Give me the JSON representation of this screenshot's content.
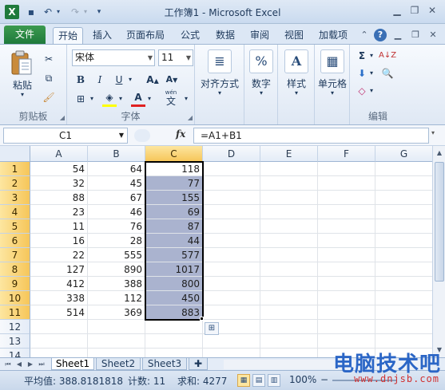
{
  "window": {
    "title": "工作簿1 - Microsoft Excel",
    "logo": "X",
    "qat": [
      "save-icon",
      "undo-icon",
      "redo-icon",
      "customize-icon"
    ]
  },
  "tabs": {
    "file": "文件",
    "items": [
      "开始",
      "插入",
      "页面布局",
      "公式",
      "数据",
      "审阅",
      "视图",
      "加载项"
    ],
    "active": "开始"
  },
  "ribbon": {
    "clipboard": {
      "label": "剪贴板",
      "paste": "粘贴"
    },
    "font": {
      "label": "字体",
      "name": "宋体",
      "size": "11",
      "wen": "wén",
      "wen_char": "文"
    },
    "alignment": {
      "label": "对齐方式"
    },
    "number": {
      "label": "数字"
    },
    "styles": {
      "label": "样式"
    },
    "cells": {
      "label": "单元格"
    },
    "editing": {
      "label": "编辑"
    }
  },
  "formula_bar": {
    "name_box": "C1",
    "fx": "fx",
    "formula": "=A1+B1"
  },
  "grid": {
    "columns": [
      "A",
      "B",
      "C",
      "D",
      "E",
      "F",
      "G"
    ],
    "selected_column": "C",
    "rows": [
      {
        "n": "1",
        "a": "54",
        "b": "64",
        "c": "118"
      },
      {
        "n": "2",
        "a": "32",
        "b": "45",
        "c": "77"
      },
      {
        "n": "3",
        "a": "88",
        "b": "67",
        "c": "155"
      },
      {
        "n": "4",
        "a": "23",
        "b": "46",
        "c": "69"
      },
      {
        "n": "5",
        "a": "11",
        "b": "76",
        "c": "87"
      },
      {
        "n": "6",
        "a": "16",
        "b": "28",
        "c": "44"
      },
      {
        "n": "7",
        "a": "22",
        "b": "555",
        "c": "577"
      },
      {
        "n": "8",
        "a": "127",
        "b": "890",
        "c": "1017"
      },
      {
        "n": "9",
        "a": "412",
        "b": "388",
        "c": "800"
      },
      {
        "n": "10",
        "a": "338",
        "b": "112",
        "c": "450"
      },
      {
        "n": "11",
        "a": "514",
        "b": "369",
        "c": "883"
      },
      {
        "n": "12",
        "a": "",
        "b": "",
        "c": ""
      },
      {
        "n": "13",
        "a": "",
        "b": "",
        "c": ""
      },
      {
        "n": "14",
        "a": "",
        "b": "",
        "c": ""
      }
    ]
  },
  "sheets": {
    "tabs": [
      "Sheet1",
      "Sheet2",
      "Sheet3"
    ],
    "active": "Sheet1"
  },
  "status": {
    "average": "平均值: 388.8181818",
    "count": "计数: 11",
    "sum": "求和: 4277",
    "zoom": "100%"
  },
  "watermark": {
    "title": "电脑技术吧",
    "url": "www.dnjsb.com"
  },
  "colors": {
    "selection_fill": "#aab3cf",
    "header_highlight": "#f6c65a",
    "file_tab": "#1f7a3c"
  }
}
